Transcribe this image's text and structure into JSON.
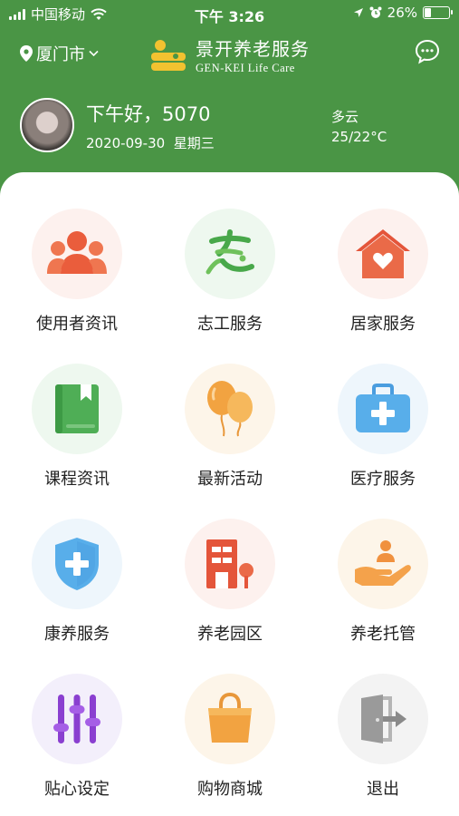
{
  "status_bar": {
    "carrier": "中国移动",
    "time": "下午 3:26",
    "battery_percent": "26%",
    "battery_level": 0.26
  },
  "header": {
    "city": "厦门市",
    "logo_cn": "景开养老服务",
    "logo_en": "GEN-KEI Life Care",
    "greeting": "下午好，5070",
    "date": "2020-09-30",
    "weekday": "星期三",
    "weather": "多云",
    "temperature": "25/22°C",
    "brand_color": "#4a9545"
  },
  "menu": [
    {
      "label": "使用者资讯",
      "icon": "users-icon",
      "bg": "#fdf1ee"
    },
    {
      "label": "志工服务",
      "icon": "volunteer-icon",
      "bg": "#eef8ef"
    },
    {
      "label": "居家服务",
      "icon": "home-heart-icon",
      "bg": "#fdf1ee"
    },
    {
      "label": "课程资讯",
      "icon": "book-icon",
      "bg": "#eef8ef"
    },
    {
      "label": "最新活动",
      "icon": "balloons-icon",
      "bg": "#fdf5e9"
    },
    {
      "label": "医疗服务",
      "icon": "medical-kit-icon",
      "bg": "#eef6fc"
    },
    {
      "label": "康养服务",
      "icon": "shield-plus-icon",
      "bg": "#eef6fc"
    },
    {
      "label": "养老园区",
      "icon": "building-icon",
      "bg": "#fdf1ee"
    },
    {
      "label": "养老托管",
      "icon": "care-hand-icon",
      "bg": "#fdf5e9"
    },
    {
      "label": "贴心设定",
      "icon": "sliders-icon",
      "bg": "#f3effb"
    },
    {
      "label": "购物商城",
      "icon": "shopping-bag-icon",
      "bg": "#fdf5e9"
    },
    {
      "label": "退出",
      "icon": "exit-door-icon",
      "bg": "#f3f3f3"
    }
  ]
}
